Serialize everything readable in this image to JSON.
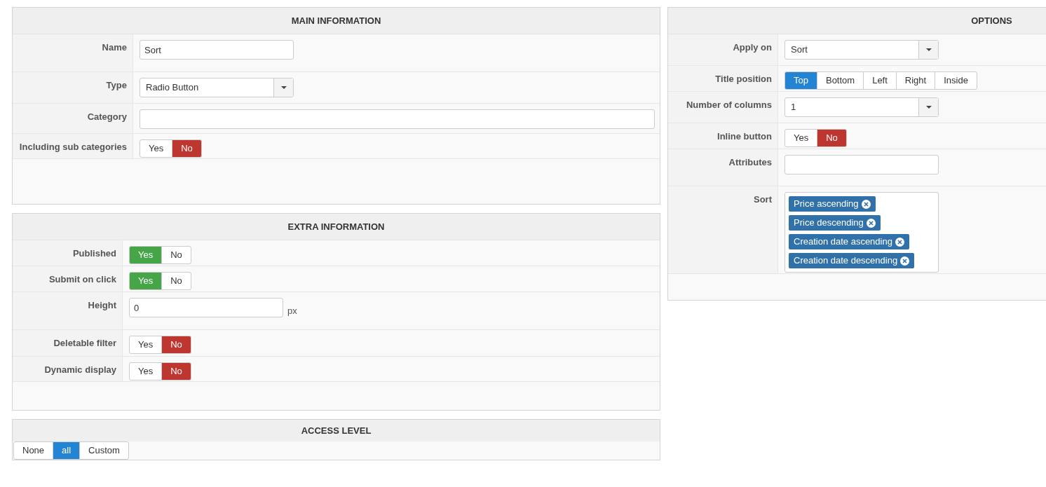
{
  "main_information": {
    "title": "MAIN INFORMATION",
    "rows": [
      {
        "kind": "text",
        "label": "Name",
        "value": "Sort"
      },
      {
        "kind": "select",
        "label": "Type",
        "value": "Radio Button"
      },
      {
        "kind": "wide_text",
        "label": "Category"
      },
      {
        "kind": "yesno",
        "label": "Including sub categories",
        "options": [
          {
            "label": "Yes",
            "selected": false
          },
          {
            "label": "No",
            "selected": true
          }
        ]
      }
    ]
  },
  "extra_information": {
    "title": "EXTRA INFORMATION",
    "rows": [
      {
        "kind": "yesno",
        "label": "Published",
        "options": [
          {
            "label": "Yes",
            "selected": true
          },
          {
            "label": "No",
            "selected": false
          }
        ]
      },
      {
        "kind": "yesno",
        "label": "Submit on click",
        "options": [
          {
            "label": "Yes",
            "selected": true
          },
          {
            "label": "No",
            "selected": false
          }
        ]
      },
      {
        "kind": "text",
        "label": "Height",
        "value": "0",
        "unit": "px"
      },
      {
        "kind": "yesno",
        "label": "Deletable filter",
        "options": [
          {
            "label": "Yes",
            "selected": false
          },
          {
            "label": "No",
            "selected": true
          }
        ]
      },
      {
        "kind": "yesno",
        "label": "Dynamic display",
        "options": [
          {
            "label": "Yes",
            "selected": false
          },
          {
            "label": "No",
            "selected": true
          }
        ]
      }
    ]
  },
  "access_level": {
    "title": "ACCESS LEVEL",
    "options": [
      {
        "label": "None",
        "selected": false
      },
      {
        "label": "all",
        "selected": true
      },
      {
        "label": "Custom",
        "selected": false
      }
    ]
  },
  "options": {
    "title": "OPTIONS",
    "rows": [
      {
        "kind": "select",
        "label": "Apply on",
        "value": "Sort"
      },
      {
        "kind": "choice",
        "label": "Title position",
        "options": [
          {
            "label": "Top",
            "selected": true
          },
          {
            "label": "Bottom",
            "selected": false
          },
          {
            "label": "Left",
            "selected": false
          },
          {
            "label": "Right",
            "selected": false
          },
          {
            "label": "Inside",
            "selected": false
          }
        ]
      },
      {
        "kind": "select",
        "label": "Number of columns",
        "value": "1"
      },
      {
        "kind": "yesno",
        "label": "Inline button",
        "options": [
          {
            "label": "Yes",
            "selected": false
          },
          {
            "label": "No",
            "selected": true
          }
        ]
      },
      {
        "kind": "text",
        "label": "Attributes"
      },
      {
        "kind": "tags",
        "label": "Sort",
        "tags": [
          "Price ascending",
          "Price descending",
          "Creation date ascending",
          "Creation date descending"
        ]
      }
    ]
  }
}
